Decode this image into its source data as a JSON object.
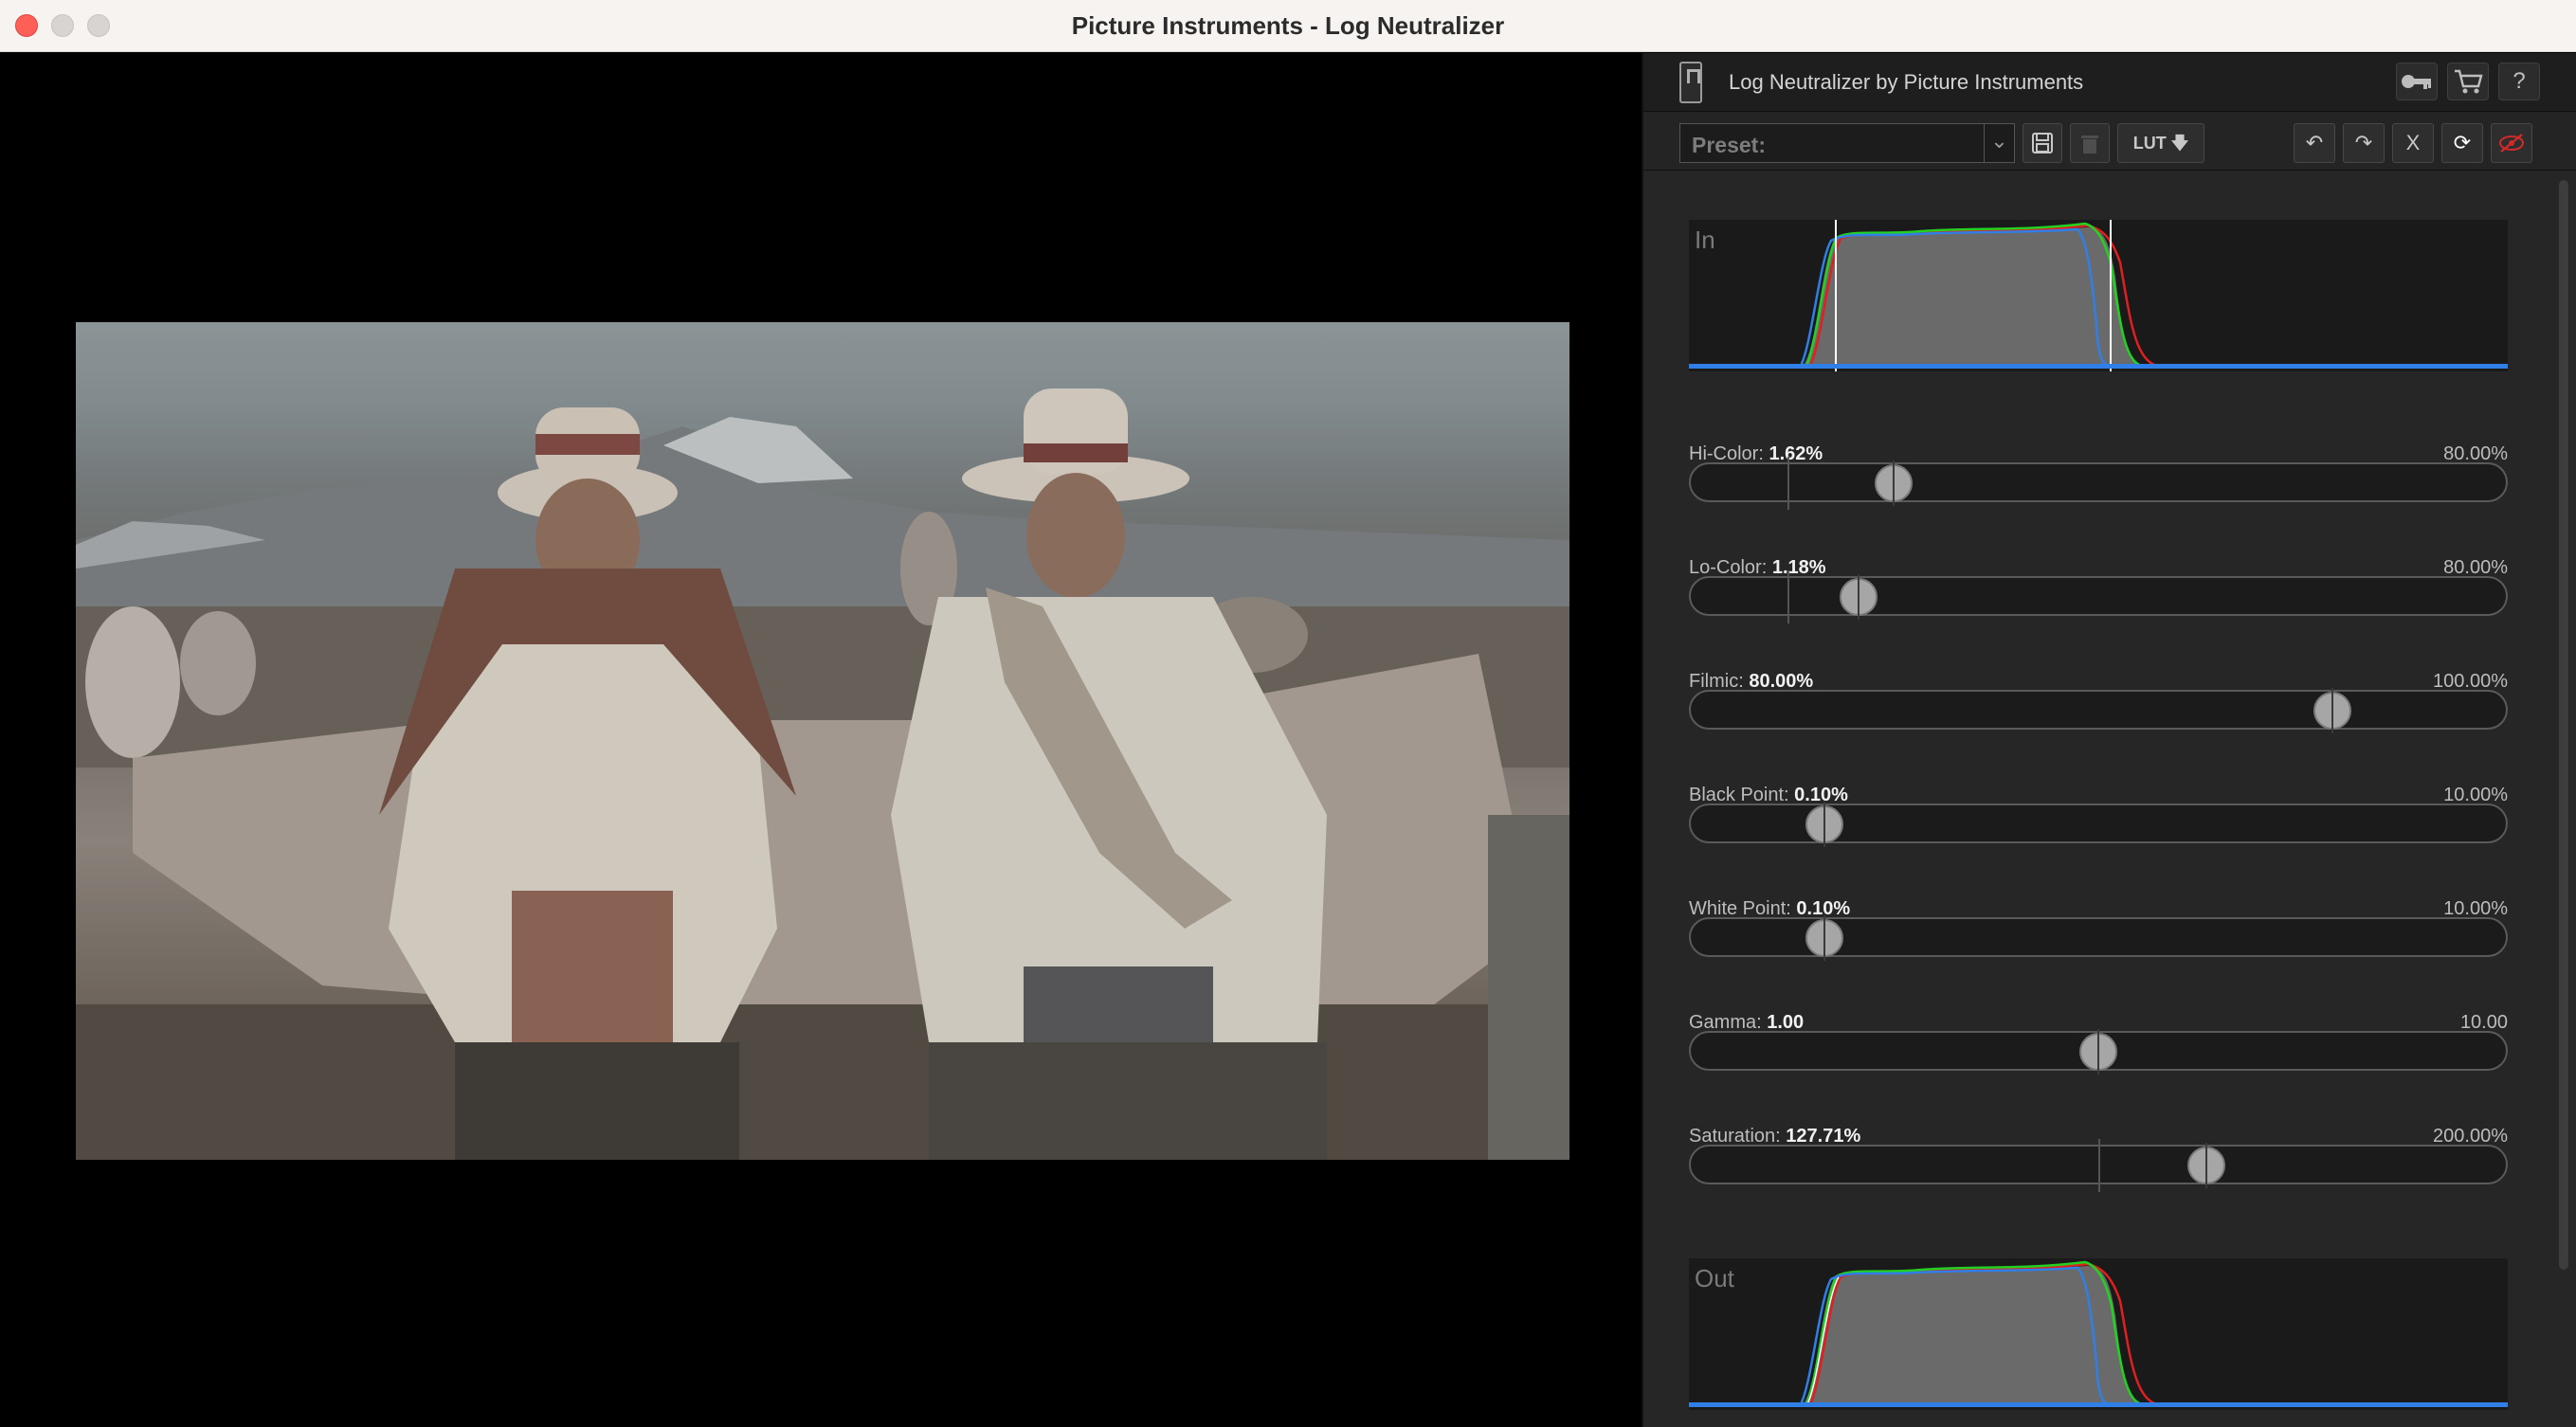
{
  "window": {
    "title": "Picture Instruments - Log Neutralizer"
  },
  "panel": {
    "app_name": "Log Neutralizer by Picture Instruments",
    "header_buttons": [
      {
        "name": "license-key-button",
        "icon": "key-icon"
      },
      {
        "name": "cart-button",
        "icon": "cart-icon"
      },
      {
        "name": "help-button",
        "icon": "help-icon",
        "label": "?"
      }
    ],
    "toolbar": {
      "preset_label": "Preset:",
      "save_icon": "save-icon",
      "delete_icon": "trash-icon",
      "lut_label": "LUT",
      "undo_icon": "undo-icon",
      "redo_icon": "redo-icon",
      "clear_label": "X",
      "reset_icon": "reset-icon",
      "bypass_icon": "eye-off-icon"
    },
    "hist_in_label": "In",
    "hist_out_label": "Out",
    "sliders": [
      {
        "name": "hi-color",
        "label": "Hi-Color:",
        "value": "1.62%",
        "max": "80.00%",
        "pos": 0.25,
        "tick": 0.12
      },
      {
        "name": "lo-color",
        "label": "Lo-Color:",
        "value": "1.18%",
        "max": "80.00%",
        "pos": 0.207,
        "tick": 0.12
      },
      {
        "name": "filmic",
        "label": "Filmic:",
        "value": "80.00%",
        "max": "100.00%",
        "pos": 0.786,
        "tick": null
      },
      {
        "name": "black-point",
        "label": "Black Point:",
        "value": "0.10%",
        "max": "10.00%",
        "pos": 0.165,
        "tick": null
      },
      {
        "name": "white-point",
        "label": "White Point:",
        "value": "0.10%",
        "max": "10.00%",
        "pos": 0.165,
        "tick": null
      },
      {
        "name": "gamma",
        "label": "Gamma:",
        "value": "1.00",
        "max": "10.00",
        "pos": 0.5,
        "tick": null
      },
      {
        "name": "saturation",
        "label": "Saturation:",
        "value": "127.71%",
        "max": "200.00%",
        "pos": 0.632,
        "tick": 0.5
      }
    ]
  },
  "colors": {
    "hist_red": "#e02020",
    "hist_green": "#22d122",
    "hist_blue": "#2f7fe6",
    "hist_fill": "#6a6a6a"
  }
}
